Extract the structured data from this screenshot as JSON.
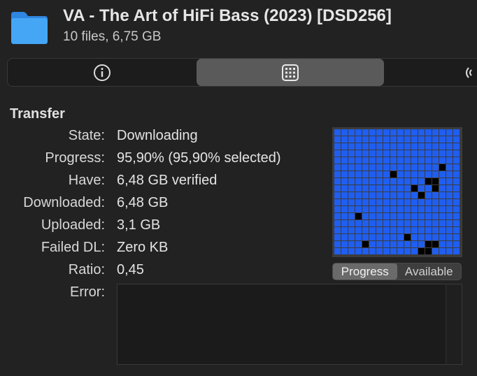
{
  "header": {
    "title": "VA - The Art of HiFi Bass (2023) [DSD256]",
    "subtitle": "10 files, 6,75 GB",
    "folder_icon": "folder-icon",
    "folder_color": "#3b9cf0"
  },
  "tabs": [
    {
      "name": "info",
      "icon": "info-icon",
      "selected": false
    },
    {
      "name": "pieces",
      "icon": "grid-icon",
      "selected": true
    },
    {
      "name": "peers",
      "icon": "peers-icon",
      "selected": false
    }
  ],
  "transfer": {
    "heading": "Transfer",
    "rows": [
      {
        "label": "State:",
        "value": "Downloading"
      },
      {
        "label": "Progress:",
        "value": "95,90% (95,90% selected)"
      },
      {
        "label": "Have:",
        "value": "6,48 GB verified"
      },
      {
        "label": "Downloaded:",
        "value": "6,48 GB"
      },
      {
        "label": "Uploaded:",
        "value": "3,1 GB"
      },
      {
        "label": "Failed DL:",
        "value": "Zero KB"
      },
      {
        "label": "Ratio:",
        "value": "0,45"
      },
      {
        "label": "Error:",
        "value": ""
      }
    ]
  },
  "pieces": {
    "colors": {
      "have": "#1f5ef0",
      "missing": "#000000"
    },
    "grid_size": 18,
    "missing_cells": [
      [
        5,
        15
      ],
      [
        6,
        8
      ],
      [
        7,
        13
      ],
      [
        7,
        14
      ],
      [
        8,
        11
      ],
      [
        8,
        14
      ],
      [
        9,
        12
      ],
      [
        12,
        3
      ],
      [
        15,
        10
      ],
      [
        16,
        4
      ],
      [
        16,
        13
      ],
      [
        16,
        14
      ],
      [
        17,
        13
      ],
      [
        17,
        12
      ]
    ],
    "toggle": {
      "options": [
        "Progress",
        "Available"
      ],
      "selected": "Progress"
    }
  }
}
